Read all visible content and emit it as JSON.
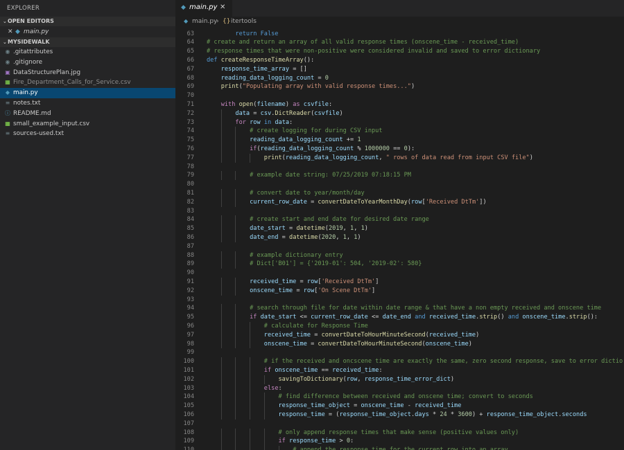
{
  "sidebar": {
    "title": "EXPLORER",
    "open_editors": {
      "header": "OPEN EDITORS",
      "items": [
        {
          "close": "✕",
          "name": "main.py"
        }
      ]
    },
    "folder": {
      "header": "MYSIDEWALK",
      "files": [
        {
          "name": ".gitattributes",
          "icon": "dot-icon",
          "selected": false,
          "dim": false
        },
        {
          "name": ".gitignore",
          "icon": "dot-icon",
          "selected": false,
          "dim": false
        },
        {
          "name": "DataStructurePlan.jpg",
          "icon": "image-icon",
          "selected": false,
          "dim": false
        },
        {
          "name": "Fire_Department_Calls_for_Service.csv",
          "icon": "csv-icon",
          "selected": false,
          "dim": true
        },
        {
          "name": "main.py",
          "icon": "python-icon",
          "selected": true,
          "dim": false
        },
        {
          "name": "notes.txt",
          "icon": "text-file-icon",
          "selected": false,
          "dim": false
        },
        {
          "name": "README.md",
          "icon": "info-icon",
          "selected": false,
          "dim": false
        },
        {
          "name": "small_example_input.csv",
          "icon": "csv-icon",
          "selected": false,
          "dim": false
        },
        {
          "name": "sources-used.txt",
          "icon": "text-file-icon",
          "selected": false,
          "dim": false
        }
      ]
    }
  },
  "tab": {
    "name": "main.py",
    "close": "✕"
  },
  "breadcrumb": {
    "file": "main.py",
    "separator": "›",
    "symbol_icon": "{}",
    "symbol": "itertools"
  },
  "editor": {
    "first_line": 63,
    "partial_top": "        return False",
    "lines": [
      [
        [
          "c-txt",
          ""
        ]
      ],
      [
        [
          "c-cmt",
          "# create and return an array of all valid response times (onscene_time - received_time)"
        ]
      ],
      [
        [
          "c-cmt",
          "# response times that were non-positive were considered invalid and saved to error dictionary"
        ]
      ],
      [
        [
          "c-kw",
          "def "
        ],
        [
          "c-fn",
          "createResponseTimeArray"
        ],
        [
          "c-txt",
          "():"
        ]
      ],
      [
        [
          "c-txt",
          "    "
        ],
        [
          "c-var",
          "response_time_array"
        ],
        [
          "c-txt",
          " = []"
        ]
      ],
      [
        [
          "c-txt",
          "    "
        ],
        [
          "c-var",
          "reading_data_logging_count"
        ],
        [
          "c-txt",
          " = "
        ],
        [
          "c-num",
          "0"
        ]
      ],
      [
        [
          "c-txt",
          "    "
        ],
        [
          "c-fn",
          "print"
        ],
        [
          "c-txt",
          "("
        ],
        [
          "c-str",
          "\"Populating array with valid response times...\""
        ],
        [
          "c-txt",
          ")"
        ]
      ],
      [
        [
          "c-txt",
          ""
        ]
      ],
      [
        [
          "c-txt",
          "    "
        ],
        [
          "c-ctrl",
          "with "
        ],
        [
          "c-fn",
          "open"
        ],
        [
          "c-txt",
          "("
        ],
        [
          "c-var",
          "filename"
        ],
        [
          "c-txt",
          ") "
        ],
        [
          "c-ctrl",
          "as "
        ],
        [
          "c-var",
          "csvfile"
        ],
        [
          "c-txt",
          ":"
        ]
      ],
      [
        [
          "c-txt",
          "        "
        ],
        [
          "c-var",
          "data"
        ],
        [
          "c-txt",
          " = "
        ],
        [
          "c-var",
          "csv"
        ],
        [
          "c-txt",
          "."
        ],
        [
          "c-fn",
          "DictReader"
        ],
        [
          "c-txt",
          "("
        ],
        [
          "c-var",
          "csvfile"
        ],
        [
          "c-txt",
          ")"
        ]
      ],
      [
        [
          "c-txt",
          "        "
        ],
        [
          "c-ctrl",
          "for "
        ],
        [
          "c-var",
          "row"
        ],
        [
          "c-kw",
          " in "
        ],
        [
          "c-var",
          "data"
        ],
        [
          "c-txt",
          ":"
        ]
      ],
      [
        [
          "c-txt",
          "            "
        ],
        [
          "c-cmt",
          "# create logging for during CSV input"
        ]
      ],
      [
        [
          "c-txt",
          "            "
        ],
        [
          "c-var",
          "reading_data_logging_count"
        ],
        [
          "c-txt",
          " += "
        ],
        [
          "c-num",
          "1"
        ]
      ],
      [
        [
          "c-txt",
          "            "
        ],
        [
          "c-ctrl",
          "if"
        ],
        [
          "c-txt",
          "("
        ],
        [
          "c-var",
          "reading_data_logging_count"
        ],
        [
          "c-txt",
          " % "
        ],
        [
          "c-num",
          "1000000"
        ],
        [
          "c-txt",
          " == "
        ],
        [
          "c-num",
          "0"
        ],
        [
          "c-txt",
          "):"
        ]
      ],
      [
        [
          "c-txt",
          "                "
        ],
        [
          "c-fn",
          "print"
        ],
        [
          "c-txt",
          "("
        ],
        [
          "c-var",
          "reading_data_logging_count"
        ],
        [
          "c-txt",
          ", "
        ],
        [
          "c-str",
          "\" rows of data read from input CSV file\""
        ],
        [
          "c-txt",
          ")"
        ]
      ],
      [
        [
          "c-txt",
          ""
        ]
      ],
      [
        [
          "c-txt",
          "            "
        ],
        [
          "c-cmt",
          "# example date string: 07/25/2019 07:18:15 PM"
        ]
      ],
      [
        [
          "c-txt",
          ""
        ]
      ],
      [
        [
          "c-txt",
          "            "
        ],
        [
          "c-cmt",
          "# convert date to year/month/day"
        ]
      ],
      [
        [
          "c-txt",
          "            "
        ],
        [
          "c-var",
          "current_row_date"
        ],
        [
          "c-txt",
          " = "
        ],
        [
          "c-fn",
          "convertDateToYearMonthDay"
        ],
        [
          "c-txt",
          "("
        ],
        [
          "c-var",
          "row"
        ],
        [
          "c-txt",
          "["
        ],
        [
          "c-str",
          "'Received DtTm'"
        ],
        [
          "c-txt",
          "])"
        ]
      ],
      [
        [
          "c-txt",
          ""
        ]
      ],
      [
        [
          "c-txt",
          "            "
        ],
        [
          "c-cmt",
          "# create start and end date for desired date range"
        ]
      ],
      [
        [
          "c-txt",
          "            "
        ],
        [
          "c-var",
          "date_start"
        ],
        [
          "c-txt",
          " = "
        ],
        [
          "c-fn",
          "datetime"
        ],
        [
          "c-txt",
          "("
        ],
        [
          "c-num",
          "2019"
        ],
        [
          "c-txt",
          ", "
        ],
        [
          "c-num",
          "1"
        ],
        [
          "c-txt",
          ", "
        ],
        [
          "c-num",
          "1"
        ],
        [
          "c-txt",
          ")"
        ]
      ],
      [
        [
          "c-txt",
          "            "
        ],
        [
          "c-var",
          "date_end"
        ],
        [
          "c-txt",
          " = "
        ],
        [
          "c-fn",
          "datetime"
        ],
        [
          "c-txt",
          "("
        ],
        [
          "c-num",
          "2020"
        ],
        [
          "c-txt",
          ", "
        ],
        [
          "c-num",
          "1"
        ],
        [
          "c-txt",
          ", "
        ],
        [
          "c-num",
          "1"
        ],
        [
          "c-txt",
          ")"
        ]
      ],
      [
        [
          "c-txt",
          ""
        ]
      ],
      [
        [
          "c-txt",
          "            "
        ],
        [
          "c-cmt",
          "# example dictionary entry"
        ]
      ],
      [
        [
          "c-txt",
          "            "
        ],
        [
          "c-cmt",
          "# Dict['B01'] = {'2019-01': 504, '2019-02': 580}"
        ]
      ],
      [
        [
          "c-txt",
          ""
        ]
      ],
      [
        [
          "c-txt",
          "            "
        ],
        [
          "c-var",
          "received_time"
        ],
        [
          "c-txt",
          " = "
        ],
        [
          "c-var",
          "row"
        ],
        [
          "c-txt",
          "["
        ],
        [
          "c-str",
          "'Received DtTm'"
        ],
        [
          "c-txt",
          "]"
        ]
      ],
      [
        [
          "c-txt",
          "            "
        ],
        [
          "c-var",
          "onscene_time"
        ],
        [
          "c-txt",
          " = "
        ],
        [
          "c-var",
          "row"
        ],
        [
          "c-txt",
          "["
        ],
        [
          "c-str",
          "'On Scene DtTm'"
        ],
        [
          "c-txt",
          "]"
        ]
      ],
      [
        [
          "c-txt",
          ""
        ]
      ],
      [
        [
          "c-txt",
          "            "
        ],
        [
          "c-cmt",
          "# search through file for date within date range & that have a non empty received and onscene time"
        ]
      ],
      [
        [
          "c-txt",
          "            "
        ],
        [
          "c-ctrl",
          "if "
        ],
        [
          "c-var",
          "date_start"
        ],
        [
          "c-txt",
          " <= "
        ],
        [
          "c-var",
          "current_row_date"
        ],
        [
          "c-txt",
          " <= "
        ],
        [
          "c-var",
          "date_end"
        ],
        [
          "c-kw",
          " and "
        ],
        [
          "c-var",
          "received_time"
        ],
        [
          "c-txt",
          "."
        ],
        [
          "c-fn",
          "strip"
        ],
        [
          "c-txt",
          "()"
        ],
        [
          "c-kw",
          " and "
        ],
        [
          "c-var",
          "onscene_time"
        ],
        [
          "c-txt",
          "."
        ],
        [
          "c-fn",
          "strip"
        ],
        [
          "c-txt",
          "():"
        ]
      ],
      [
        [
          "c-txt",
          "                "
        ],
        [
          "c-cmt",
          "# calculate for Response Time"
        ]
      ],
      [
        [
          "c-txt",
          "                "
        ],
        [
          "c-var",
          "received_time"
        ],
        [
          "c-txt",
          " = "
        ],
        [
          "c-fn",
          "convertDateToHourMinuteSecond"
        ],
        [
          "c-txt",
          "("
        ],
        [
          "c-var",
          "received_time"
        ],
        [
          "c-txt",
          ")"
        ]
      ],
      [
        [
          "c-txt",
          "                "
        ],
        [
          "c-var",
          "onscene_time"
        ],
        [
          "c-txt",
          " = "
        ],
        [
          "c-fn",
          "convertDateToHourMinuteSecond"
        ],
        [
          "c-txt",
          "("
        ],
        [
          "c-var",
          "onscene_time"
        ],
        [
          "c-txt",
          ")"
        ]
      ],
      [
        [
          "c-txt",
          ""
        ]
      ],
      [
        [
          "c-txt",
          "                "
        ],
        [
          "c-cmt",
          "# if the received and oncscene time are exactly the same, zero second response, save to error dictio"
        ]
      ],
      [
        [
          "c-txt",
          "                "
        ],
        [
          "c-ctrl",
          "if "
        ],
        [
          "c-var",
          "onscene_time"
        ],
        [
          "c-txt",
          " == "
        ],
        [
          "c-var",
          "received_time"
        ],
        [
          "c-txt",
          ":"
        ]
      ],
      [
        [
          "c-txt",
          "                    "
        ],
        [
          "c-fn",
          "savingToDictionary"
        ],
        [
          "c-txt",
          "("
        ],
        [
          "c-var",
          "row"
        ],
        [
          "c-txt",
          ", "
        ],
        [
          "c-var",
          "response_time_error_dict"
        ],
        [
          "c-txt",
          ")"
        ]
      ],
      [
        [
          "c-txt",
          "                "
        ],
        [
          "c-ctrl",
          "else"
        ],
        [
          "c-txt",
          ":"
        ]
      ],
      [
        [
          "c-txt",
          "                    "
        ],
        [
          "c-cmt",
          "# find difference between received and onscene time; convert to seconds"
        ]
      ],
      [
        [
          "c-txt",
          "                    "
        ],
        [
          "c-var",
          "response_time_object"
        ],
        [
          "c-txt",
          " = "
        ],
        [
          "c-var",
          "onscene_time"
        ],
        [
          "c-txt",
          " - "
        ],
        [
          "c-var",
          "received_time"
        ]
      ],
      [
        [
          "c-txt",
          "                    "
        ],
        [
          "c-var",
          "response_time"
        ],
        [
          "c-txt",
          " = ("
        ],
        [
          "c-var",
          "response_time_object"
        ],
        [
          "c-txt",
          "."
        ],
        [
          "c-var",
          "days"
        ],
        [
          "c-txt",
          " * "
        ],
        [
          "c-num",
          "24"
        ],
        [
          "c-txt",
          " * "
        ],
        [
          "c-num",
          "3600"
        ],
        [
          "c-txt",
          ") + "
        ],
        [
          "c-var",
          "response_time_object"
        ],
        [
          "c-txt",
          "."
        ],
        [
          "c-var",
          "seconds"
        ]
      ],
      [
        [
          "c-txt",
          ""
        ]
      ],
      [
        [
          "c-txt",
          "                    "
        ],
        [
          "c-cmt",
          "# only append response times that make sense (positive values only)"
        ]
      ],
      [
        [
          "c-txt",
          "                    "
        ],
        [
          "c-ctrl",
          "if "
        ],
        [
          "c-var",
          "response_time"
        ],
        [
          "c-txt",
          " > "
        ],
        [
          "c-num",
          "0"
        ],
        [
          "c-txt",
          ":"
        ]
      ],
      [
        [
          "c-txt",
          "                        "
        ],
        [
          "c-cmt",
          "# append the response time for the current row into an array"
        ]
      ]
    ]
  },
  "colors": {
    "sidebar_bg": "#252526",
    "editor_bg": "#1e1e1e",
    "selection": "#094771",
    "python_icon": "#519aba"
  }
}
